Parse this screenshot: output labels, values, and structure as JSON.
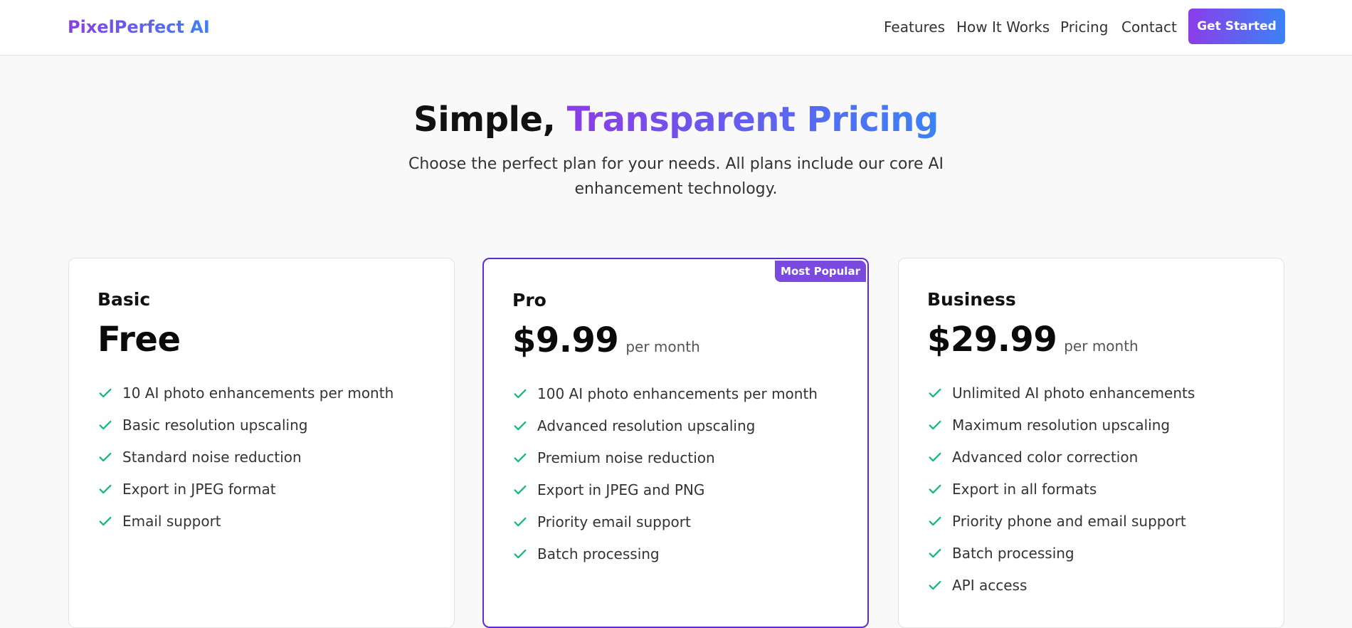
{
  "brand": {
    "logo_text": "PixelPerfect AI",
    "gradient_start": "#8b3de8",
    "gradient_end": "#3b82f6"
  },
  "nav": {
    "links": [
      "Features",
      "How It Works",
      "Pricing",
      "Contact"
    ],
    "cta_label": "Get Started"
  },
  "hero": {
    "title_plain": "Simple, ",
    "title_highlight": "Transparent Pricing",
    "subtitle": "Choose the perfect plan for your needs. All plans include our core AI enhancement technology."
  },
  "plans": [
    {
      "name": "Basic",
      "price": "Free",
      "period": "",
      "badge": "",
      "features": [
        "10 AI photo enhancements per month",
        "Basic resolution upscaling",
        "Standard noise reduction",
        "Export in JPEG format",
        "Email support"
      ]
    },
    {
      "name": "Pro",
      "price": "$9.99",
      "period": "per month",
      "badge": "Most Popular",
      "features": [
        "100 AI photo enhancements per month",
        "Advanced resolution upscaling",
        "Premium noise reduction",
        "Export in JPEG and PNG",
        "Priority email support",
        "Batch processing"
      ]
    },
    {
      "name": "Business",
      "price": "$29.99",
      "period": "per month",
      "badge": "",
      "features": [
        "Unlimited AI photo enhancements",
        "Maximum resolution upscaling",
        "Advanced color correction",
        "Export in all formats",
        "Priority phone and email support",
        "Batch processing",
        "API access"
      ]
    }
  ],
  "colors": {
    "check": "#10b981",
    "featured_border": "#5b2bd9",
    "badge_bg": "#7a4ade"
  },
  "icons": {
    "feature_check": "check-icon"
  }
}
